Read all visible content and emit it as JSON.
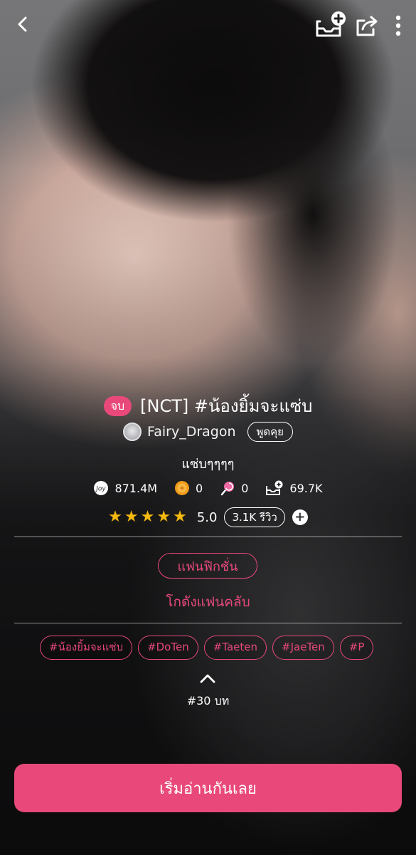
{
  "story": {
    "status_badge": "จบ",
    "title": "[NCT] #น้องยิ้มจะแซ่บ",
    "author": "Fairy_Dragon",
    "chat_label": "พูดคุย",
    "subtitle": "แซ่บๆๆๆๆ"
  },
  "stats": {
    "views": "871.4M",
    "coins": "0",
    "candies": "0",
    "library_adds": "69.7K"
  },
  "rating": {
    "stars": 5,
    "value": "5.0",
    "reviews_label": "3.1K รีวิว"
  },
  "category": "แฟนฟิกชั่น",
  "fanclub_link": "โกดังแฟนคลับ",
  "tags": [
    "#น้องยิ้มจะแซ่บ",
    "#DoTen",
    "#Taeten",
    "#JaeTen",
    "#P"
  ],
  "chapters": "#30 บท",
  "start_button": "เริ่มอ่านกันเลย",
  "icons": {
    "back": "back-arrow-icon",
    "library": "add-to-library-icon",
    "share": "share-icon",
    "more": "more-vertical-icon",
    "views": "joy-views-icon",
    "coins": "coin-icon",
    "candies": "lollipop-icon",
    "library_stat": "library-add-icon"
  },
  "colors": {
    "accent": "#e8497a",
    "star": "#f5b90f"
  }
}
